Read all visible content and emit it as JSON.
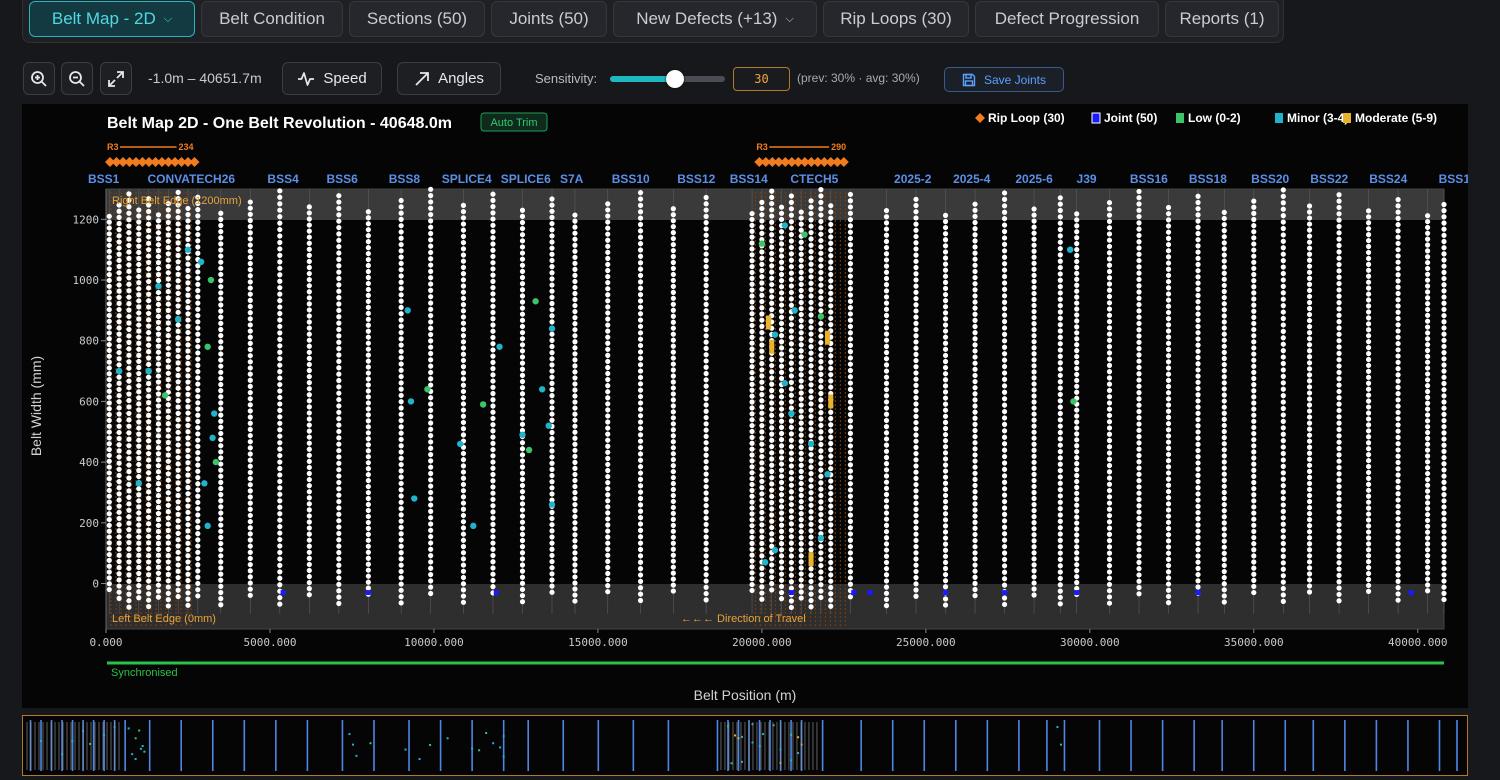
{
  "tabs": [
    {
      "label": "Belt Map - 2D",
      "dropdown": true,
      "active": true
    },
    {
      "label": "Belt Condition",
      "dropdown": false,
      "active": false
    },
    {
      "label": "Sections (50)",
      "dropdown": false,
      "active": false
    },
    {
      "label": "Joints (50)",
      "dropdown": false,
      "active": false
    },
    {
      "label": "New Defects (+13)",
      "dropdown": true,
      "active": false
    },
    {
      "label": "Rip Loops (30)",
      "dropdown": false,
      "active": false
    },
    {
      "label": "Defect Progression",
      "dropdown": false,
      "active": false
    },
    {
      "label": "Reports (1)",
      "dropdown": false,
      "active": false
    }
  ],
  "toolbar": {
    "zoom_in_icon": "zoom-in-icon",
    "zoom_out_icon": "zoom-out-icon",
    "fit_icon": "expand-icon",
    "range_text": "-1.0m – 40651.7m",
    "speed_label": "Speed",
    "angles_label": "Angles",
    "sensitivity_label": "Sensitivity:",
    "sensitivity_value": "30",
    "sensitivity_fraction": 0.3,
    "sensitivity_note": "(prev: 30% · avg: 30%)",
    "save_label": "Save Joints"
  },
  "colors": {
    "accent": "#1fb7c2",
    "rip_loop": "#f07c1e",
    "joint": "#1a1aff",
    "low": "#3cc46b",
    "minor": "#1fb3cc",
    "moderate": "#e8b22a",
    "section_label": "#5b8fe8",
    "sync": "#29c24a"
  },
  "chart_data": {
    "type": "scatter",
    "title": "Belt Map 2D - One Belt Revolution - 40648.0m",
    "badge": "Auto Trim",
    "xlabel": "Belt Position (m)",
    "ylabel": "Belt Width (mm)",
    "xlim": [
      0,
      40800
    ],
    "ylim": [
      -150,
      1300
    ],
    "xticks": [
      0,
      5000,
      10000,
      15000,
      20000,
      25000,
      30000,
      35000,
      40000
    ],
    "xtick_labels": [
      "0.000",
      "5000.000",
      "10000.000",
      "15000.000",
      "20000.000",
      "25000.000",
      "30000.000",
      "35000.000",
      "40000.000"
    ],
    "yticks": [
      0,
      200,
      400,
      600,
      800,
      1000,
      1200
    ],
    "grid": false,
    "legend_position": "top-right",
    "legend": [
      {
        "label": "Rip Loop (30)",
        "marker": "diamond",
        "color": "#f07c1e"
      },
      {
        "label": "Joint (50)",
        "marker": "square",
        "color": "#1a1aff"
      },
      {
        "label": "Low (0-2)",
        "marker": "square",
        "color": "#3cc46b"
      },
      {
        "label": "Minor (3-4)",
        "marker": "square",
        "color": "#1fb3cc"
      },
      {
        "label": "Moderate (5-9)",
        "marker": "square",
        "color": "#e8b22a"
      }
    ],
    "right_edge_label": "Right Belt Edge (1200mm)",
    "left_edge_label": "Left Belt Edge (0mm)",
    "direction_label": "←←← Direction of Travel",
    "sync_label": "Synchronised",
    "sections": [
      {
        "label": "BSS1",
        "x": 0
      },
      {
        "label": "CONVATECH26",
        "x": 2600
      },
      {
        "label": "BSS4",
        "x": 5400
      },
      {
        "label": "BSS6",
        "x": 7200
      },
      {
        "label": "BSS8",
        "x": 9100
      },
      {
        "label": "SPLICE4",
        "x": 11000
      },
      {
        "label": "SPLICE6",
        "x": 12800
      },
      {
        "label": "S7A",
        "x": 14200
      },
      {
        "label": "BSS10",
        "x": 16000
      },
      {
        "label": "BSS12",
        "x": 18000
      },
      {
        "label": "BSS14",
        "x": 19600
      },
      {
        "label": "CTECH5",
        "x": 21600
      },
      {
        "label": "2025-2",
        "x": 24600
      },
      {
        "label": "2025-4",
        "x": 26400
      },
      {
        "label": "2025-6",
        "x": 28300
      },
      {
        "label": "J39",
        "x": 29900
      },
      {
        "label": "BSS16",
        "x": 31800
      },
      {
        "label": "BSS18",
        "x": 33600
      },
      {
        "label": "BSS20",
        "x": 35500
      },
      {
        "label": "BSS22",
        "x": 37300
      },
      {
        "label": "BSS24",
        "x": 39100
      },
      {
        "label": "BSS1",
        "x": 40800
      }
    ],
    "rip_loop_groups": [
      {
        "x_start": 0,
        "x_end": 2700,
        "label": "R3",
        "label_end": "234"
      },
      {
        "x_start": 19800,
        "x_end": 22600,
        "label": "R3",
        "label_end": "290"
      }
    ],
    "scan_lines_x": [
      100,
      400,
      700,
      1000,
      1300,
      1600,
      1900,
      2200,
      2500,
      2800,
      3500,
      4400,
      5300,
      6200,
      7100,
      8000,
      9000,
      9900,
      10900,
      11800,
      12700,
      13600,
      14300,
      15300,
      16300,
      17300,
      18300,
      19700,
      20000,
      20300,
      20600,
      20900,
      21200,
      21500,
      21800,
      22100,
      22700,
      23800,
      24700,
      25600,
      26500,
      27400,
      28300,
      29100,
      29600,
      30600,
      31500,
      32400,
      33300,
      34100,
      35000,
      35900,
      36700,
      37600,
      38500,
      39400,
      40300,
      40800
    ],
    "joints_x": [
      5400,
      8000,
      11900,
      20900,
      22800,
      23300,
      25600,
      27400,
      29600,
      33300,
      39800
    ],
    "defects": [
      {
        "x": 2900,
        "y": 1060,
        "severity": "minor"
      },
      {
        "x": 3200,
        "y": 1000,
        "severity": "low"
      },
      {
        "x": 2500,
        "y": 1100,
        "severity": "minor"
      },
      {
        "x": 3100,
        "y": 780,
        "severity": "low"
      },
      {
        "x": 3300,
        "y": 560,
        "severity": "minor"
      },
      {
        "x": 3250,
        "y": 480,
        "severity": "minor"
      },
      {
        "x": 3350,
        "y": 400,
        "severity": "low"
      },
      {
        "x": 3000,
        "y": 330,
        "severity": "minor"
      },
      {
        "x": 3100,
        "y": 190,
        "severity": "minor"
      },
      {
        "x": 1300,
        "y": 700,
        "severity": "minor"
      },
      {
        "x": 1600,
        "y": 980,
        "severity": "minor"
      },
      {
        "x": 1800,
        "y": 620,
        "severity": "low"
      },
      {
        "x": 2200,
        "y": 870,
        "severity": "minor"
      },
      {
        "x": 400,
        "y": 700,
        "severity": "minor"
      },
      {
        "x": 1000,
        "y": 330,
        "severity": "minor"
      },
      {
        "x": 9200,
        "y": 900,
        "severity": "minor"
      },
      {
        "x": 9300,
        "y": 600,
        "severity": "minor"
      },
      {
        "x": 9400,
        "y": 280,
        "severity": "minor"
      },
      {
        "x": 9800,
        "y": 640,
        "severity": "low"
      },
      {
        "x": 10800,
        "y": 460,
        "severity": "minor"
      },
      {
        "x": 11500,
        "y": 590,
        "severity": "low"
      },
      {
        "x": 11200,
        "y": 190,
        "severity": "minor"
      },
      {
        "x": 12000,
        "y": 780,
        "severity": "minor"
      },
      {
        "x": 12700,
        "y": 490,
        "severity": "minor"
      },
      {
        "x": 12900,
        "y": 440,
        "severity": "low"
      },
      {
        "x": 13100,
        "y": 930,
        "severity": "low"
      },
      {
        "x": 13300,
        "y": 640,
        "severity": "minor"
      },
      {
        "x": 13500,
        "y": 520,
        "severity": "minor"
      },
      {
        "x": 13600,
        "y": 840,
        "severity": "minor"
      },
      {
        "x": 13600,
        "y": 260,
        "severity": "minor"
      },
      {
        "x": 20000,
        "y": 1120,
        "severity": "low"
      },
      {
        "x": 20400,
        "y": 820,
        "severity": "minor"
      },
      {
        "x": 20700,
        "y": 1180,
        "severity": "minor"
      },
      {
        "x": 20200,
        "y": 860,
        "severity": "moderate"
      },
      {
        "x": 20300,
        "y": 780,
        "severity": "moderate"
      },
      {
        "x": 20700,
        "y": 660,
        "severity": "minor"
      },
      {
        "x": 21000,
        "y": 900,
        "severity": "minor"
      },
      {
        "x": 21300,
        "y": 1150,
        "severity": "low"
      },
      {
        "x": 21500,
        "y": 460,
        "severity": "minor"
      },
      {
        "x": 21800,
        "y": 880,
        "severity": "low"
      },
      {
        "x": 22000,
        "y": 810,
        "severity": "moderate"
      },
      {
        "x": 22100,
        "y": 600,
        "severity": "moderate"
      },
      {
        "x": 22000,
        "y": 360,
        "severity": "minor"
      },
      {
        "x": 20100,
        "y": 70,
        "severity": "minor"
      },
      {
        "x": 20400,
        "y": 110,
        "severity": "minor"
      },
      {
        "x": 21500,
        "y": 80,
        "severity": "moderate"
      },
      {
        "x": 21800,
        "y": 150,
        "severity": "minor"
      },
      {
        "x": 20900,
        "y": 560,
        "severity": "minor"
      },
      {
        "x": 29400,
        "y": 1100,
        "severity": "minor"
      },
      {
        "x": 29500,
        "y": 600,
        "severity": "low"
      }
    ]
  }
}
